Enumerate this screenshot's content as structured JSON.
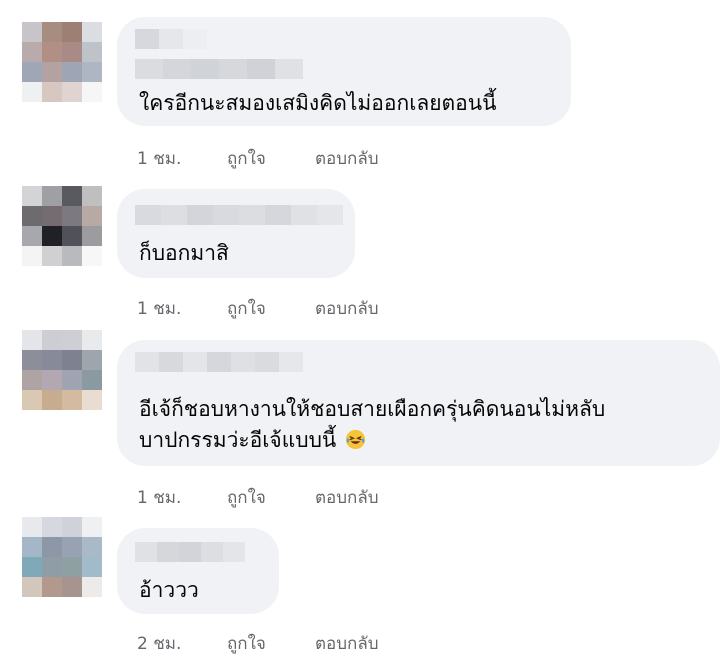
{
  "comments": [
    {
      "text_lines": [
        "ใครอีกนะสมองเสมิงคิดไม่ออกเลยตอนนี้"
      ],
      "time": "1 ชม.",
      "like": "ถูกใจ",
      "reply": "ตอบกลับ"
    },
    {
      "text_lines": [
        "ก็บอกมาสิ"
      ],
      "time": "1 ชม.",
      "like": "ถูกใจ",
      "reply": "ตอบกลับ"
    },
    {
      "text_lines": [
        "อีเจ้ก็ชอบหางานให้ชอบสายเผือกครุ่นคิดนอนไม่หลับ",
        "บาปกรรมว่ะอีเจ้แบบนี้"
      ],
      "emoji": "laughing-crying-emoji",
      "time": "1 ชม.",
      "like": "ถูกใจ",
      "reply": "ตอบกลับ"
    },
    {
      "text_lines": [
        "อ้าววว"
      ],
      "time": "2 ชม.",
      "like": "ถูกใจ",
      "reply": "ตอบกลับ"
    }
  ],
  "colors": {
    "bubble": "#f0f2f5",
    "meta_text": "#65676b",
    "body_text": "#050505"
  }
}
